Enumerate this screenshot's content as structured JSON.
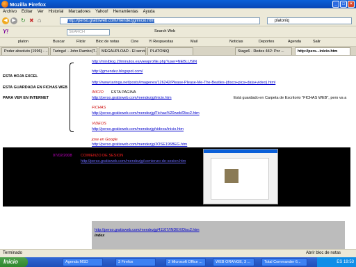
{
  "window": {
    "title": "Mozilla Firefox"
  },
  "menu": [
    "Archivo",
    "Editar",
    "Ver",
    "Historial",
    "Marcadores",
    "Yahoo!",
    "Herramientas",
    "Ayuda"
  ],
  "nav": {
    "url": "http://perso.gratisweb.com/mendezjg/inicio.htm",
    "search_value": "platoniq",
    "search_web": "Search Web"
  },
  "yahoo_bar": {
    "input_value": "platon",
    "input_placeholder": "SEARCH",
    "search_web": "Search Web"
  },
  "bookmarks_bar": [
    {
      "label": "Buscar"
    },
    {
      "label": "Flickr"
    },
    {
      "label": "Bloc de notas"
    },
    {
      "label": "Cine"
    },
    {
      "label": "Yi Respuestas"
    },
    {
      "label": "Mail"
    },
    {
      "label": "Noticias"
    },
    {
      "label": "Deportes"
    },
    {
      "label": "Agenda"
    },
    {
      "label": "Salir"
    }
  ],
  "tabs": [
    {
      "label": "Poder absoluto (1996) - ..."
    },
    {
      "label": "Taringa! - John Rambo(T..."
    },
    {
      "label": "MEGAUPLOAD - El servici..."
    },
    {
      "label": "PLATONIQ"
    },
    {
      "label": "Stage6 · Redes 442: Por ..."
    },
    {
      "label": "http://pers...inicio.htm"
    }
  ],
  "page": {
    "left_labels": [
      "ESTA HOJA EXCEL",
      "ESTA GUARDADA EN FICHAS WEB",
      "PARA VER EN INTERNET"
    ],
    "links_top": [
      "http://miniblog.20minutos.es/viewprofile.php?user=NEBLUSIN",
      "http://jgmendez.blogspot.com/",
      "http://www.taringa.net/posts/imagenes/126242/Please-Please-Me-The-Beatles-(disco+pics+data+video).html"
    ],
    "inicio": "INICIO",
    "esta_pagina": "ESTA PAGINA",
    "inicio_link": "http://perso.gratisweb.com/mendezjg/inicio.htm",
    "right_note": "Está guardado en Carpeta de Escritorio \"FICHAS WEB\", pero va a",
    "fichas": "FICHAS",
    "fichas_link": "http://perso.gratisweb.com/mendezjg/Fichas%20web/Disc2.htm",
    "videos": "VIDEOS",
    "videos_link": "http://perso.gratisweb.com/mendezjg/videos/inicio.htm",
    "google": "jose en Google",
    "google_link": "http://perso.gratisweb.com/mendezjg/JOSE196BEG.htm",
    "date": "07/02/2008",
    "comienzo": "COMIENZO DE SESION",
    "comienzo_link": "http://perso.gratisweb.com/mendezjg/comienzo-de-sesion.htm",
    "index_link": "http://perso.gratisweb.com/mendezjg/41107/INDEX/Disc2.htm",
    "index": "index"
  },
  "status": {
    "text": "Terminado",
    "right": "Abrir bloc de notas"
  },
  "taskbar": {
    "start": "Inicio",
    "tasks": [
      "Agenda MSD",
      "3 Firefox",
      "2 Microsoft Office ...",
      "WEB ORANGE, 3 ...",
      "Total Commander 6..."
    ],
    "lang": "ES",
    "time": "19:53"
  },
  "colors": {
    "link": "#0000cc",
    "accent_red": "#cc0000",
    "titlebar": "#0a5fd8",
    "chrome": "#ece9d8"
  }
}
